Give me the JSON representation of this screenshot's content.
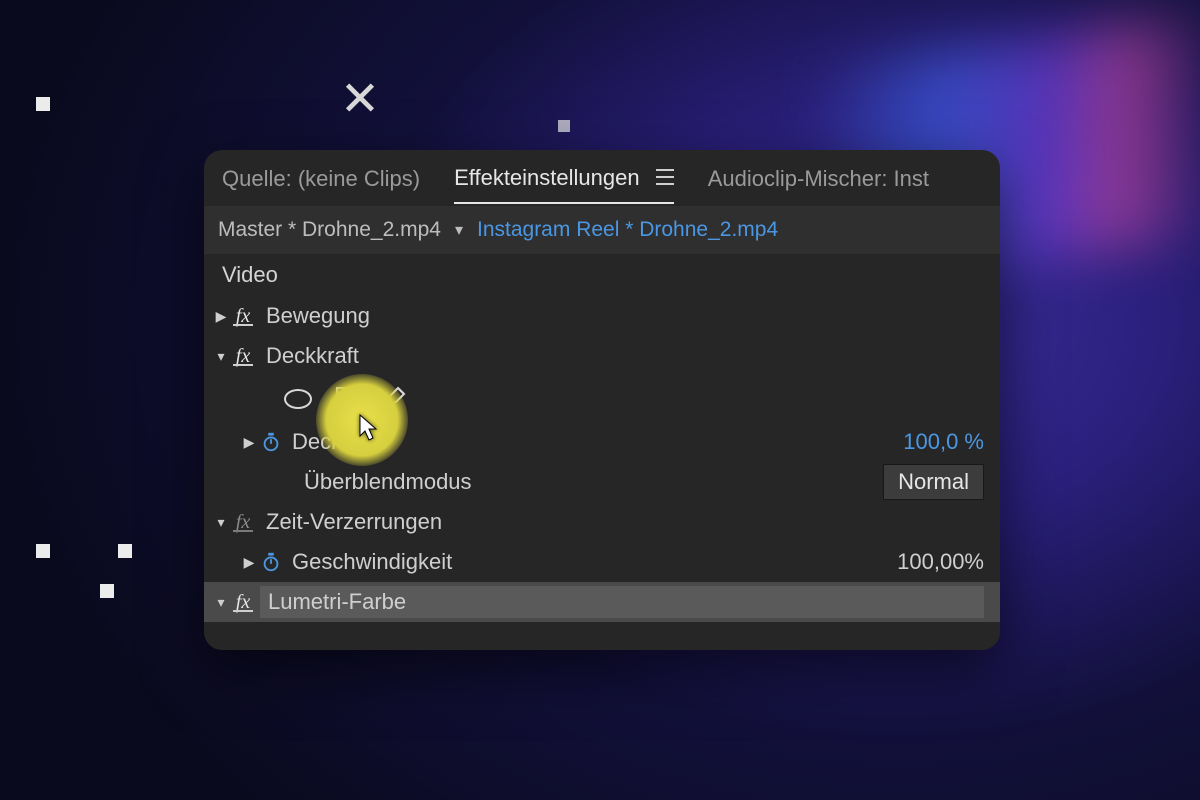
{
  "tabs": {
    "source": "Quelle: (keine Clips)",
    "effects": "Effekteinstellungen",
    "audio": "Audioclip-Mischer: Inst"
  },
  "crumbs": {
    "master": "Master * Drohne_2.mp4",
    "sequence": "Instagram Reel * Drohne_2.mp4"
  },
  "section": "Video",
  "fx": {
    "motion": "Bewegung",
    "opacity": "Deckkraft",
    "opacity_prop": "Deckkraft",
    "opacity_value": "100,0 %",
    "blend_label": "Überblendmodus",
    "blend_value": "Normal",
    "time": "Zeit-Verzerrungen",
    "speed_label": "Geschwindigkeit",
    "speed_value": "100,00%",
    "lumetri": "Lumetri-Farbe"
  }
}
